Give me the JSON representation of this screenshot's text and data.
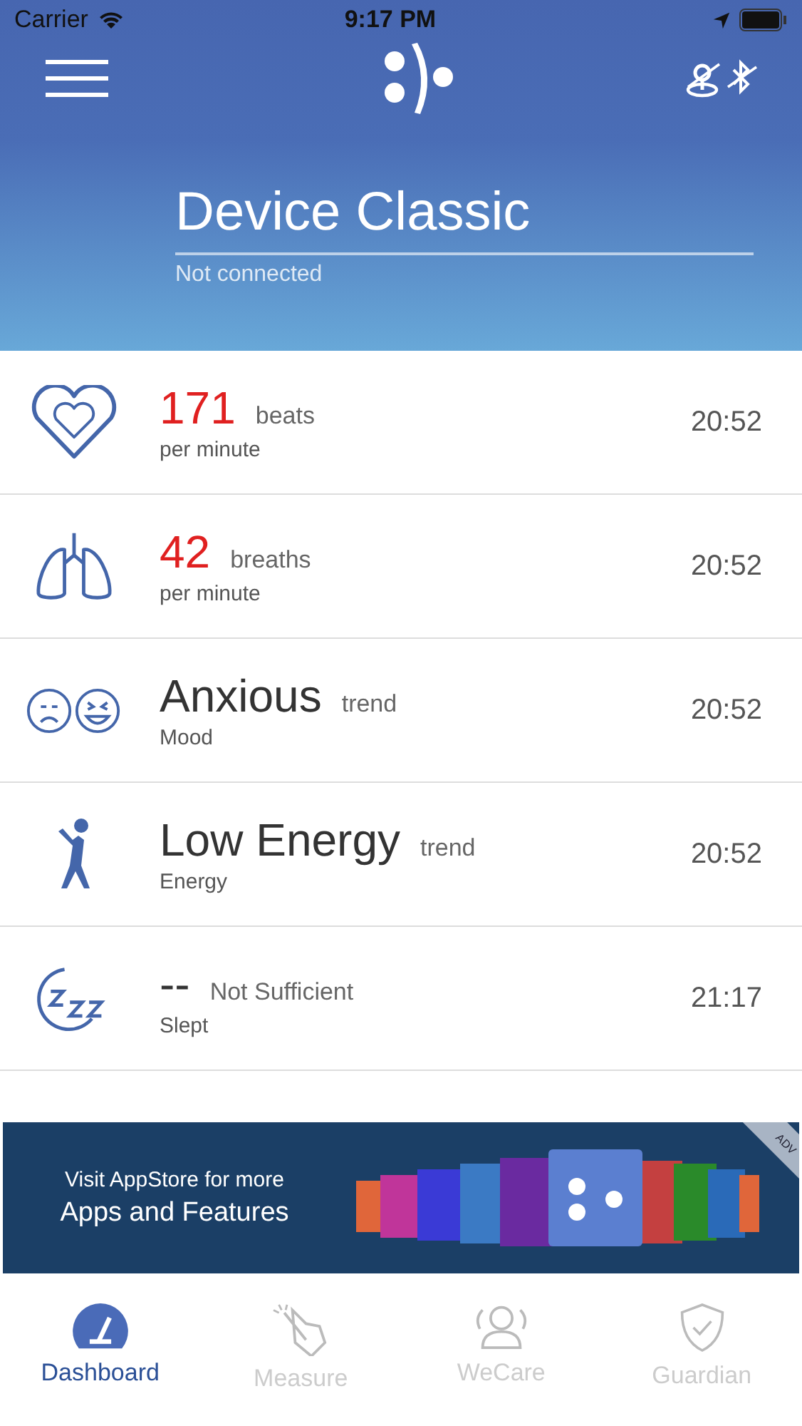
{
  "status_bar": {
    "carrier": "Carrier",
    "time": "9:17 PM"
  },
  "header": {
    "device_name": "Device Classic",
    "connection_status": "Not connected"
  },
  "metrics": [
    {
      "kind": "heart",
      "value": "171",
      "alert": true,
      "unit": "beats",
      "label": "per minute",
      "time": "20:52"
    },
    {
      "kind": "lungs",
      "value": "42",
      "alert": true,
      "unit": "breaths",
      "label": "per minute",
      "time": "20:52"
    },
    {
      "kind": "mood",
      "value": "Anxious",
      "alert": false,
      "unit": "trend",
      "label": "Mood",
      "time": "20:52"
    },
    {
      "kind": "energy",
      "value": "Low Energy",
      "alert": false,
      "unit": "trend",
      "label": "Energy",
      "time": "20:52"
    },
    {
      "kind": "sleep",
      "value": "--",
      "alert": false,
      "unit": "Not Sufficient",
      "label": "Slept",
      "time": "21:17"
    }
  ],
  "ad_banner": {
    "line_1": "Visit AppStore for more",
    "line_2": "Apps and Features",
    "corner_label": "ADV"
  },
  "tabs": [
    {
      "kind": "dashboard",
      "label": "Dashboard",
      "selected": true
    },
    {
      "kind": "measure",
      "label": "Measure",
      "selected": false
    },
    {
      "kind": "wecare",
      "label": "WeCare",
      "selected": false
    },
    {
      "kind": "guardian",
      "label": "Guardian",
      "selected": false
    }
  ]
}
